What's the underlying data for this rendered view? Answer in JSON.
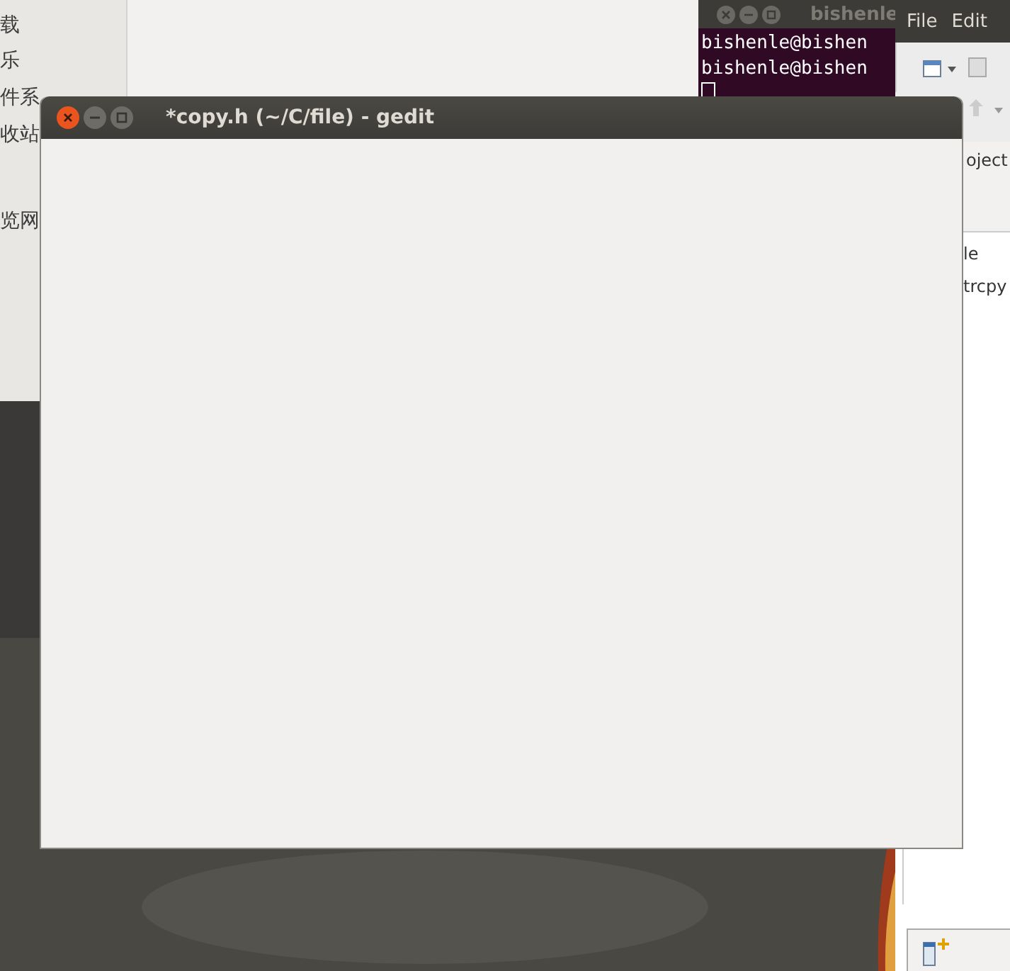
{
  "file_manager": {
    "sidebar": {
      "items": [
        {
          "label": "载"
        },
        {
          "label": "乐"
        },
        {
          "label": "件系"
        },
        {
          "label": "收站"
        },
        {
          "label": "览网"
        }
      ]
    }
  },
  "terminal": {
    "title": "bishenle",
    "lines": [
      "bishenle@bishen",
      "bishenle@bishen"
    ]
  },
  "eclipse": {
    "menu": [
      "File",
      "Edit"
    ],
    "panel_title": "oject",
    "tree": [
      "le",
      "trcpy"
    ]
  },
  "gedit": {
    "title": "*copy.h (~/C/file) - gedit"
  }
}
